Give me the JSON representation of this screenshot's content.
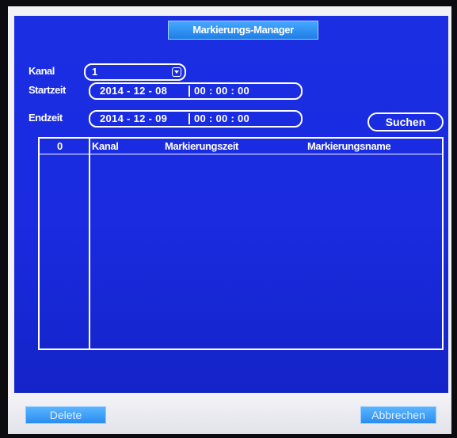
{
  "window": {
    "title": "Markierungs-Manager"
  },
  "form": {
    "kanal_label": "Kanal",
    "kanal_value": "1",
    "startzeit_label": "Startzeit",
    "startzeit_date": "2014 - 12 - 08",
    "startzeit_time": "00 : 00 : 00",
    "endzeit_label": "Endzeit",
    "endzeit_date": "2014 - 12 - 09",
    "endzeit_time": "00 : 00 : 00",
    "search_label": "Suchen"
  },
  "table": {
    "count": "0",
    "columns": [
      "Kanal",
      "Markierungszeit",
      "Markierungsname"
    ],
    "rows": []
  },
  "footer": {
    "delete_label": "Delete",
    "cancel_label": "Abbrechen"
  },
  "colors": {
    "panel_blue": "#1b2ee2",
    "button_blue": "#2a8ef0",
    "text": "#ffffff"
  }
}
